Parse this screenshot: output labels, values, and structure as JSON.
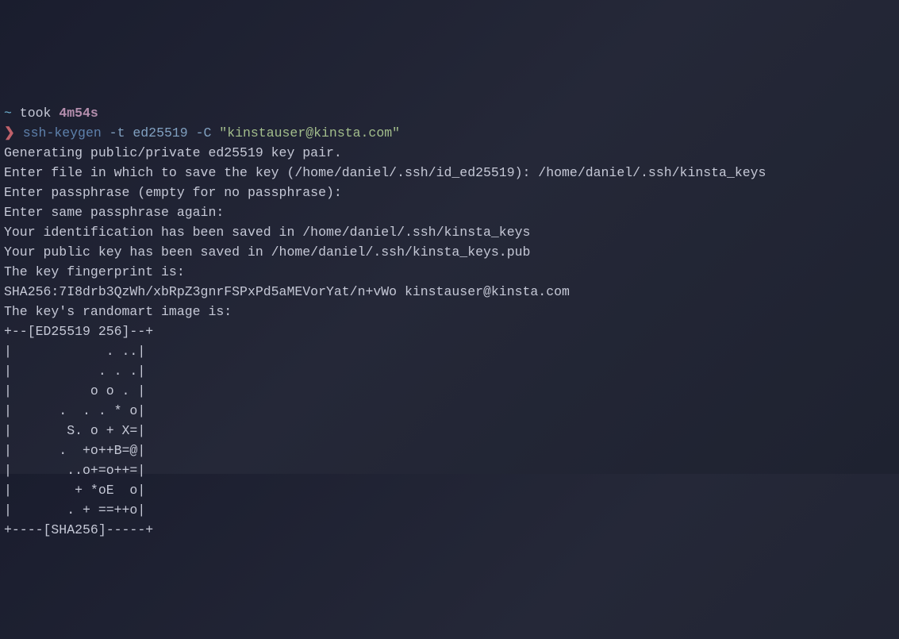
{
  "prompt": {
    "tilde": "~",
    "took_label": " took ",
    "duration": "4m54s",
    "arrow": "❯ ",
    "command": "ssh-keygen",
    "flag1": " -t ",
    "arg1": "ed25519",
    "flag2": " -C ",
    "string_arg": "\"kinstauser@kinsta.com\""
  },
  "output": {
    "line1": "Generating public/private ed25519 key pair.",
    "line2": "Enter file in which to save the key (/home/daniel/.ssh/id_ed25519): /home/daniel/.ssh/kinsta_keys",
    "line3": "Enter passphrase (empty for no passphrase):",
    "line4": "Enter same passphrase again:",
    "line5": "Your identification has been saved in /home/daniel/.ssh/kinsta_keys",
    "line6": "Your public key has been saved in /home/daniel/.ssh/kinsta_keys.pub",
    "line7": "The key fingerprint is:",
    "line8": "SHA256:7I8drb3QzWh/xbRpZ3gnrFSPxPd5aMEVorYat/n+vWo kinstauser@kinsta.com",
    "line9": "The key's randomart image is:",
    "art01": "+--[ED25519 256]--+",
    "art02": "|            . ..|",
    "art03": "|           . . .|",
    "art04": "|          o o . |",
    "art05": "|      .  . . * o|",
    "art06": "|       S. o + X=|",
    "art07": "|      .  +o++B=@|",
    "art08": "|       ..o+=o++=|",
    "art09": "|        + *oE  o|",
    "art10": "|       . + ==++o|",
    "art11": "+----[SHA256]-----+"
  }
}
